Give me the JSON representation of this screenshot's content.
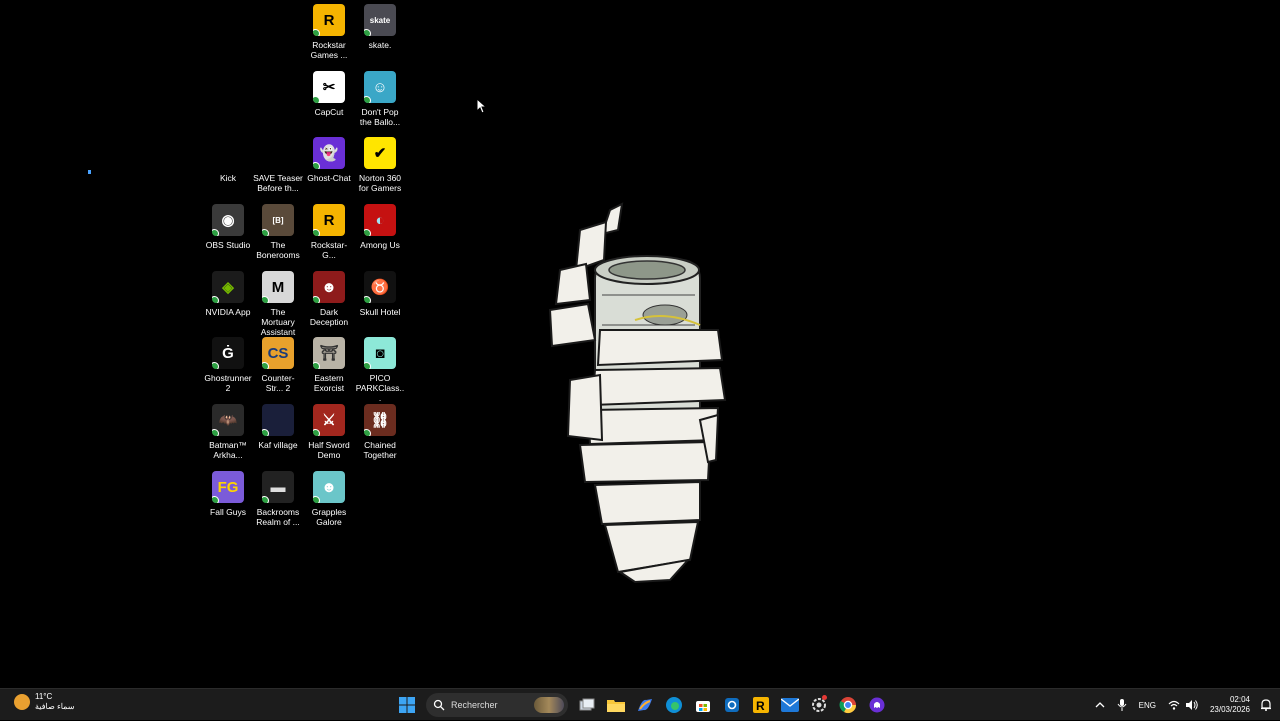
{
  "desktop": {
    "icons": [
      {
        "label": "Rockstar Games ...",
        "symbol": "R",
        "bg": "#f5b400",
        "fg": "#000",
        "badge": true
      },
      {
        "label": "skate.",
        "symbol": "skate",
        "bg": "#4a4a52",
        "fg": "#fff",
        "badge": true
      },
      {
        "label": "CapCut",
        "symbol": "✂",
        "bg": "#ffffff",
        "fg": "#000",
        "badge": true
      },
      {
        "label": "Don't Pop the Ballo...",
        "symbol": "☺",
        "bg": "#3aa7c7",
        "fg": "#fff",
        "badge": true
      },
      {
        "label": "Kick",
        "symbol": "",
        "bg": "#000000",
        "fg": "#fff",
        "badge": false
      },
      {
        "label": "SAVE Teaser Before th...",
        "symbol": "",
        "bg": "#000000",
        "fg": "#fff",
        "badge": false
      },
      {
        "label": "Ghost-Chat",
        "symbol": "👻",
        "bg": "#6a2fd6",
        "fg": "#fff",
        "badge": true
      },
      {
        "label": "Norton 360 for Gamers",
        "symbol": "✔",
        "bg": "#ffe500",
        "fg": "#000",
        "badge": false
      },
      {
        "label": "OBS Studio",
        "symbol": "◉",
        "bg": "#3a3a3a",
        "fg": "#fff",
        "badge": true
      },
      {
        "label": "The Bonerooms",
        "symbol": "[B]",
        "bg": "#5a4a3a",
        "fg": "#fff",
        "badge": true
      },
      {
        "label": "Rockstar-G...",
        "symbol": "R",
        "bg": "#f5b400",
        "fg": "#000",
        "badge": true
      },
      {
        "label": "Among Us",
        "symbol": "◐",
        "bg": "#c51111",
        "fg": "#9fe3f2",
        "badge": true
      },
      {
        "label": "NVIDIA App",
        "symbol": "◈",
        "bg": "#1b1b1b",
        "fg": "#76b900",
        "badge": true
      },
      {
        "label": "The Mortuary Assistant D...",
        "symbol": "M",
        "bg": "#d8d8d8",
        "fg": "#000",
        "badge": true
      },
      {
        "label": "Dark Deception",
        "symbol": "☻",
        "bg": "#8e1b1b",
        "fg": "#fff",
        "badge": true
      },
      {
        "label": "Skull Hotel",
        "symbol": "♉",
        "bg": "#111111",
        "fg": "#e8d8a0",
        "badge": true
      },
      {
        "label": "Ghostrunner 2",
        "symbol": "Ġ",
        "bg": "#111111",
        "fg": "#fff",
        "badge": true
      },
      {
        "label": "Counter-Str... 2",
        "symbol": "CS",
        "bg": "#e8a12c",
        "fg": "#1a3b7a",
        "badge": true
      },
      {
        "label": "Eastern Exorcist",
        "symbol": "⛩",
        "bg": "#b9b3a6",
        "fg": "#333",
        "badge": true
      },
      {
        "label": "PICO PARKClass...",
        "symbol": "◙",
        "bg": "#8de8d8",
        "fg": "#000",
        "badge": true
      },
      {
        "label": "Batman™ Arkha...",
        "symbol": "🦇",
        "bg": "#2a2a2a",
        "fg": "#fff",
        "badge": true
      },
      {
        "label": "Kaf village",
        "symbol": "",
        "bg": "#1a1f3a",
        "fg": "#fff",
        "badge": true
      },
      {
        "label": "Half Sword Demo",
        "symbol": "⚔",
        "bg": "#a2271e",
        "fg": "#fff",
        "badge": true
      },
      {
        "label": "Chained Together",
        "symbol": "⛓",
        "bg": "#6b2c1f",
        "fg": "#fff",
        "badge": true
      },
      {
        "label": "Fall Guys",
        "symbol": "FG",
        "bg": "#7b5bd9",
        "fg": "#ffd400",
        "badge": true
      },
      {
        "label": "Backrooms Realm of ...",
        "symbol": "▬",
        "bg": "#222222",
        "fg": "#ddd",
        "badge": true
      },
      {
        "label": "Grapples Galore",
        "symbol": "☻",
        "bg": "#6bc6c9",
        "fg": "#fff",
        "badge": true
      }
    ]
  },
  "taskbar": {
    "weather": {
      "temp": "11°C",
      "desc": "سماء صافية"
    },
    "search_placeholder": "Rechercher",
    "pinned": [
      {
        "name": "start-button",
        "icon": "windows-icon"
      },
      {
        "name": "task-view-button",
        "icon": "task-view-icon"
      },
      {
        "name": "file-explorer-button",
        "icon": "folder-icon"
      },
      {
        "name": "copilot-button",
        "icon": "copilot-icon"
      },
      {
        "name": "edge-button",
        "icon": "edge-icon"
      },
      {
        "name": "store-button",
        "icon": "store-icon"
      },
      {
        "name": "outlook-button",
        "icon": "outlook-icon"
      },
      {
        "name": "rockstar-button",
        "icon": "rockstar-icon"
      },
      {
        "name": "mail-button",
        "icon": "mail-icon"
      },
      {
        "name": "app-button",
        "icon": "gear-icon"
      },
      {
        "name": "chrome-button",
        "icon": "chrome-icon"
      },
      {
        "name": "ghost-chat-button",
        "icon": "ghost-icon"
      }
    ],
    "language": "ENG",
    "time": "02:04",
    "date": "23/03/2026"
  }
}
